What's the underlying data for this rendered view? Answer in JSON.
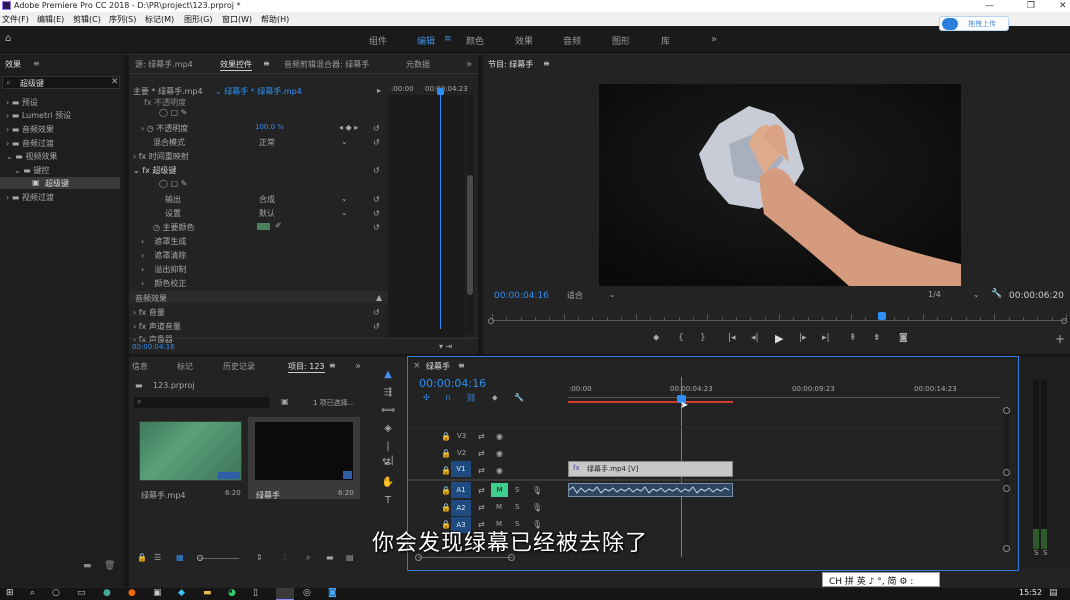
{
  "titlebar": {
    "title": "Adobe Premiere Pro CC 2018 - D:\\PR\\project\\123.prproj *"
  },
  "menu": [
    "文件(F)",
    "编辑(E)",
    "剪辑(C)",
    "序列(S)",
    "标记(M)",
    "图形(G)",
    "窗口(W)",
    "帮助(H)"
  ],
  "workspaces": [
    "组件",
    "编辑",
    "颜色",
    "效果",
    "音频",
    "图形",
    "库"
  ],
  "workspace_active": "编辑",
  "cloud_upload": "拖拽上传",
  "effects_panel": {
    "title": "效果",
    "search_value": "超级键",
    "tree": [
      "预设",
      "Lumetri 预设",
      "音频效果",
      "音频过渡",
      "视频效果",
      "键控",
      "超级键",
      "视频过渡"
    ]
  },
  "effect_controls": {
    "tabs": [
      "源: 绿幕手.mp4",
      "效果控件",
      "音频剪辑混合器: 绿幕手",
      "元数据"
    ],
    "clip_master": "主要 * 绿幕手.mp4",
    "clip_sequence": "绿幕手 * 绿幕手.mp4",
    "ruler_start": ":00:00",
    "ruler_mid": "00:00:04:23",
    "rows": {
      "opacity_header": "不透明度",
      "opacity": "不透明度",
      "opacity_value": "100.0 %",
      "blend": "混合模式",
      "blend_value": "正常",
      "time_remap": "时间重映射",
      "ultra_key": "超级键",
      "output": "输出",
      "output_value": "合成",
      "setting": "设置",
      "setting_value": "默认",
      "key_color": "主要颜色",
      "matte_gen": "遮罩生成",
      "matte_clean": "遮罩清除",
      "spill": "溢出抑制",
      "color_correct": "颜色校正",
      "audio_effects": "音频效果",
      "volume": "音量",
      "channel_volume": "声道音量",
      "panner": "声像器"
    },
    "time": "00:00:04:16",
    "key_color_hex": "#4e7d5e"
  },
  "program": {
    "title": "节目: 绿幕手",
    "timecode": "00:00:04:16",
    "fit": "适合",
    "resolution": "1/4",
    "duration": "00:00:06:20",
    "playhead_fraction": 0.68
  },
  "project": {
    "tabs": [
      "信息",
      "标记",
      "历史记录",
      "项目: 123"
    ],
    "file": "123.prproj",
    "selected": "1 项已选择...",
    "items": [
      {
        "name": "绿幕手.mp4",
        "dur": "6:20"
      },
      {
        "name": "绿幕手",
        "dur": "6:20"
      }
    ]
  },
  "timeline": {
    "title": "绿幕手",
    "timecode": "00:00:04:16",
    "ruler": [
      ":00:00",
      "00:00:04:23",
      "00:00:09:23",
      "00:00:14:23"
    ],
    "tracks_video": [
      "V3",
      "V2",
      "V1"
    ],
    "tracks_audio": [
      "A1",
      "A2",
      "A3"
    ],
    "clip_label": "绿幕手.mp4 [V]",
    "btn_m": "M",
    "btn_s": "S"
  },
  "subtitle": "你会发现绿幕已经被去除了",
  "ime": "CH 拼 英 ♪ °, 简 ⚙ :",
  "clock": "15:52",
  "colors": {
    "accent": "#2e8ff5",
    "panel": "#232323",
    "highlight_m": "#3ecf8e"
  }
}
